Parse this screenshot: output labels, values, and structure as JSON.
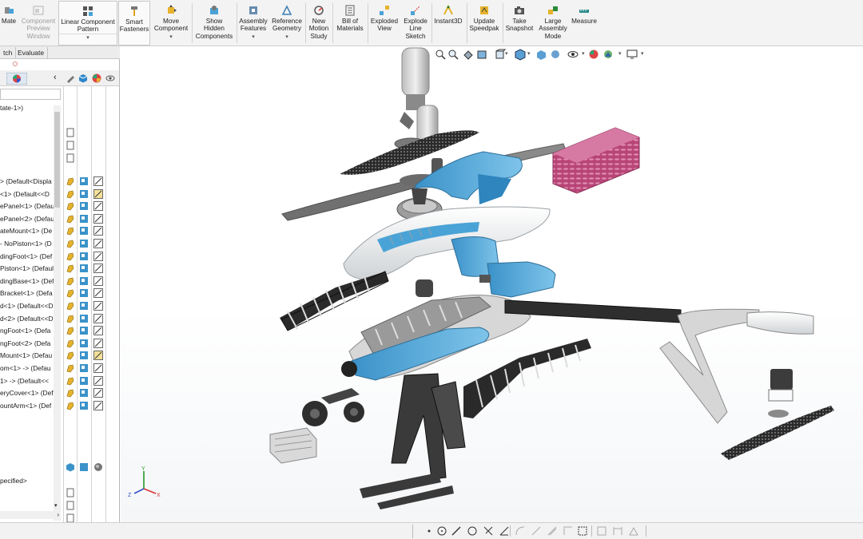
{
  "ribbon": {
    "buttons": [
      {
        "name": "mate-button",
        "label": "Mate",
        "icon": "mate-icon"
      },
      {
        "name": "component-preview-window-button",
        "label": "Component\nPreview\nWindow",
        "icon": "preview-window-icon",
        "disabled": true
      },
      {
        "name": "linear-component-pattern-button",
        "label": "Linear Component\nPattern",
        "icon": "pattern-icon"
      },
      {
        "name": "smart-fasteners-button",
        "label": "Smart\nFasteners",
        "icon": "fastener-icon"
      },
      {
        "name": "move-component-button",
        "label": "Move\nComponent",
        "icon": "move-icon"
      },
      {
        "name": "show-hidden-components-button",
        "label": "Show\nHidden\nComponents",
        "icon": "show-hidden-icon"
      },
      {
        "name": "assembly-features-button",
        "label": "Assembly\nFeatures",
        "icon": "assembly-features-icon"
      },
      {
        "name": "reference-geometry-button",
        "label": "Reference\nGeometry",
        "icon": "reference-geometry-icon"
      },
      {
        "name": "new-motion-study-button",
        "label": "New\nMotion\nStudy",
        "icon": "motion-study-icon"
      },
      {
        "name": "bill-of-materials-button",
        "label": "Bill of\nMaterials",
        "icon": "bom-icon"
      },
      {
        "name": "exploded-view-button",
        "label": "Exploded\nView",
        "icon": "exploded-view-icon"
      },
      {
        "name": "explode-line-sketch-button",
        "label": "Explode\nLine\nSketch",
        "icon": "explode-line-icon"
      },
      {
        "name": "instant3d-button",
        "label": "Instant3D",
        "icon": "instant3d-icon"
      },
      {
        "name": "update-speedpak-button",
        "label": "Update\nSpeedpak",
        "icon": "speedpak-icon"
      },
      {
        "name": "take-snapshot-button",
        "label": "Take\nSnapshot",
        "icon": "camera-icon"
      },
      {
        "name": "large-assembly-mode-button",
        "label": "Large\nAssembly\nMode",
        "icon": "large-assembly-icon"
      },
      {
        "name": "measure-button",
        "label": "Measure",
        "icon": "measure-icon"
      }
    ]
  },
  "tabs": [
    {
      "label": "tch",
      "active": false
    },
    {
      "label": "Evaluate",
      "active": false
    }
  ],
  "tree": {
    "header_item": "tate-1>)",
    "items": [
      {
        "label": "> (Default<Displa"
      },
      {
        "label": "<1> (Default<<D"
      },
      {
        "label": "ePanel<1> (Defau"
      },
      {
        "label": "ePanel<2> (Defau"
      },
      {
        "label": "ateMount<1> (De"
      },
      {
        "label": "- NoPiston<1> (D"
      },
      {
        "label": "dingFoot<1> (Def"
      },
      {
        "label": "Piston<1> (Defaul"
      },
      {
        "label": "dingBase<1> (Def"
      },
      {
        "label": "Bracket<1> (Defa"
      },
      {
        "label": "d<1> (Default<<D"
      },
      {
        "label": "d<2> (Default<<D"
      },
      {
        "label": "ngFoot<1> (Defa"
      },
      {
        "label": "ngFoot<2> (Defa"
      },
      {
        "label": "Mount<1> (Defau"
      },
      {
        "label": "om<1> -> (Defau"
      },
      {
        "label": "1> -> (Default<<"
      },
      {
        "label": "eryCover<1> (Def"
      },
      {
        "label": "ountArm<1> (Def"
      }
    ],
    "footer_item": "pecified>"
  },
  "colors": {
    "accent_blue": "#4aa3d6",
    "gray_part": "#8a8a8a",
    "light_part": "#e8e8e8",
    "dark_part": "#3a3a3a",
    "battery_pink": "#c8568a"
  }
}
